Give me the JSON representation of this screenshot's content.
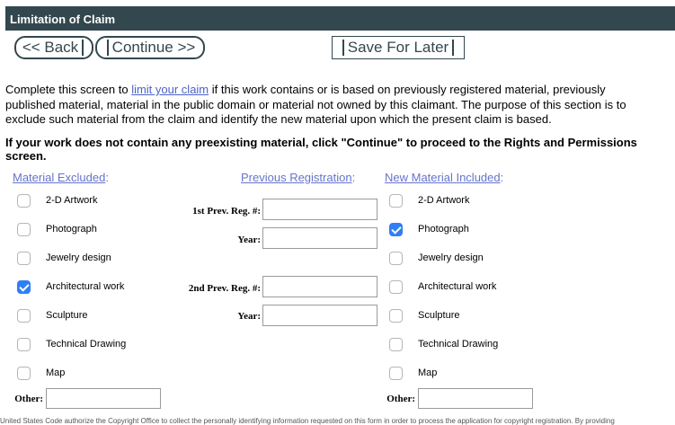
{
  "header": {
    "title": "Limitation of Claim"
  },
  "nav": {
    "back_label": "<< Back",
    "continue_label": "Continue >>",
    "save_label": "Save For Later"
  },
  "intro": {
    "before_link": "Complete this screen to ",
    "link": "limit your claim",
    "after_link": " if this work contains or is based on previously registered material, previously published material, material in the public domain or material not owned by this claimant. The purpose of this section is to exclude such material from the claim and identify the new material upon which the present claim is based."
  },
  "note": "If your work does not contain any preexisting material, click \"Continue\" to proceed to the Rights and Permissions screen.",
  "columns": {
    "excluded": "Material Excluded",
    "previous": "Previous Registration",
    "new": "New Material Included",
    "colon": ":"
  },
  "excluded_items": [
    {
      "label": "2-D Artwork",
      "checked": false
    },
    {
      "label": "Photograph",
      "checked": false
    },
    {
      "label": "Jewelry design",
      "checked": false
    },
    {
      "label": "Architectural work",
      "checked": true
    },
    {
      "label": "Sculpture",
      "checked": false
    },
    {
      "label": "Technical Drawing",
      "checked": false
    },
    {
      "label": "Map",
      "checked": false
    }
  ],
  "new_items": [
    {
      "label": "2-D Artwork",
      "checked": false
    },
    {
      "label": "Photograph",
      "checked": true
    },
    {
      "label": "Jewelry design",
      "checked": false
    },
    {
      "label": "Architectural work",
      "checked": false
    },
    {
      "label": "Sculpture",
      "checked": false
    },
    {
      "label": "Technical Drawing",
      "checked": false
    },
    {
      "label": "Map",
      "checked": false
    }
  ],
  "registration": {
    "first_label": "1st Prev. Reg. #:",
    "first_year_label": "Year:",
    "second_label": "2nd Prev. Reg. #:",
    "second_year_label": "Year:",
    "first_value": "",
    "first_year_value": "",
    "second_value": "",
    "second_year_value": ""
  },
  "other": {
    "excluded_label": "Other:",
    "new_label": "Other:",
    "excluded_value": "",
    "new_value": ""
  },
  "footer": "United States Code authorize the Copyright Office to collect the personally identifying information requested on this form in order to process the application for copyright registration. By providing"
}
